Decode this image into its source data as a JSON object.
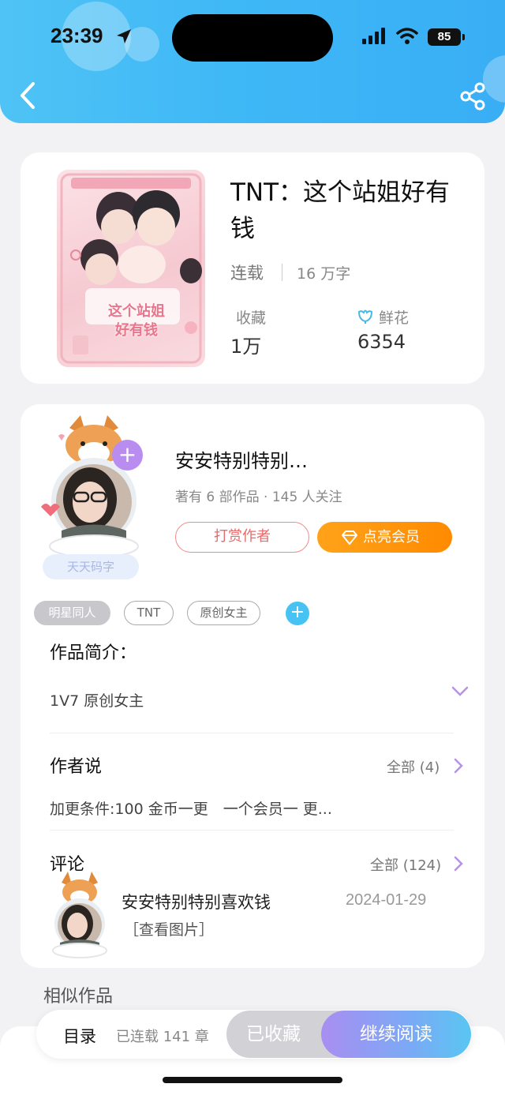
{
  "status_bar": {
    "time": "23:39",
    "battery": "85"
  },
  "book": {
    "title": "TNT：这个站姐好有钱",
    "status": "连载",
    "word_count": "16 万字",
    "favorites_label": "收藏",
    "favorites_value": "1万",
    "flowers_label": "鲜花",
    "flowers_value": "6354",
    "cover_text": "这个站姐好有钱"
  },
  "author": {
    "name": "安安特别特别…",
    "meta": "著有 6 部作品 · 145 人关注",
    "tip_button": "打赏作者",
    "vip_button": "点亮会员",
    "badge": "天天码字",
    "follow_symbol": "+"
  },
  "tags": [
    "明星同人",
    "TNT",
    "原创女主"
  ],
  "tag_add_symbol": "+",
  "intro": {
    "title": "作品简介：",
    "text": "1V7 原创女主"
  },
  "author_says": {
    "title": "作者说",
    "view_all": "全部 (4)",
    "text": "加更条件:100 金币一更　一个会员一 更..."
  },
  "comments": {
    "title": "评论",
    "view_all": "全部 (124)",
    "items": [
      {
        "user": "安安特别特别喜欢钱",
        "date": "2024-01-29",
        "text": "［查看图片］"
      }
    ]
  },
  "similar_title": "相似作品",
  "bottom_bar": {
    "toc": "目录",
    "chapters": "已连载 141 章",
    "favorited": "已收藏",
    "continue": "继续阅读"
  },
  "colors": {
    "header": "#3fb8f6",
    "vip": "#ff8a00",
    "tip": "#e86a6a",
    "accent_purple": "#b98cf0"
  }
}
